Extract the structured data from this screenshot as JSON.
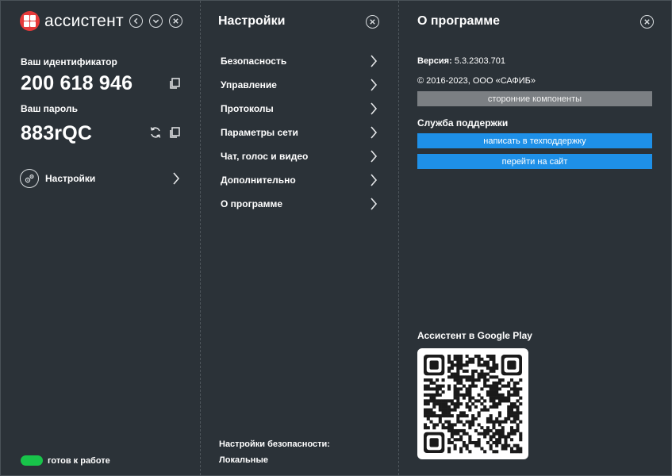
{
  "app": {
    "brand": "ассистент",
    "logo_color": "#e63a3a"
  },
  "left": {
    "id_label": "Ваш идентификатор",
    "id_value": "200 618 946",
    "password_label": "Ваш пароль",
    "password_value": "883rQC",
    "settings_label": "Настройки",
    "status_text": "готов к работе",
    "status_color": "#18c44a"
  },
  "settings": {
    "title": "Настройки",
    "items": [
      {
        "label": "Безопасность"
      },
      {
        "label": "Управление"
      },
      {
        "label": "Протоколы"
      },
      {
        "label": "Параметры сети"
      },
      {
        "label": "Чат, голос и видео"
      },
      {
        "label": "Дополнительно"
      },
      {
        "label": "О программе"
      }
    ],
    "security_caption": "Настройки безопасности:",
    "security_value": "Локальные"
  },
  "about": {
    "title": "О программе",
    "version_label": "Версия:",
    "version_value": "5.3.2303.701",
    "copyright": "© 2016-2023, ООО «САФИБ»",
    "third_party_button": "сторонние компоненты",
    "support_heading": "Служба поддержки",
    "support_button": "написать в техподдержку",
    "site_button": "перейти на сайт",
    "google_play_heading": "Ассистент в Google Play",
    "accent_color": "#1e90e8"
  },
  "icons": {
    "back": "arrow-left-icon",
    "minimize": "chevron-down-icon",
    "close": "close-icon",
    "copy": "copy-icon",
    "refresh": "refresh-icon",
    "gear": "gear-icon",
    "chevron": "chevron-right-icon"
  }
}
